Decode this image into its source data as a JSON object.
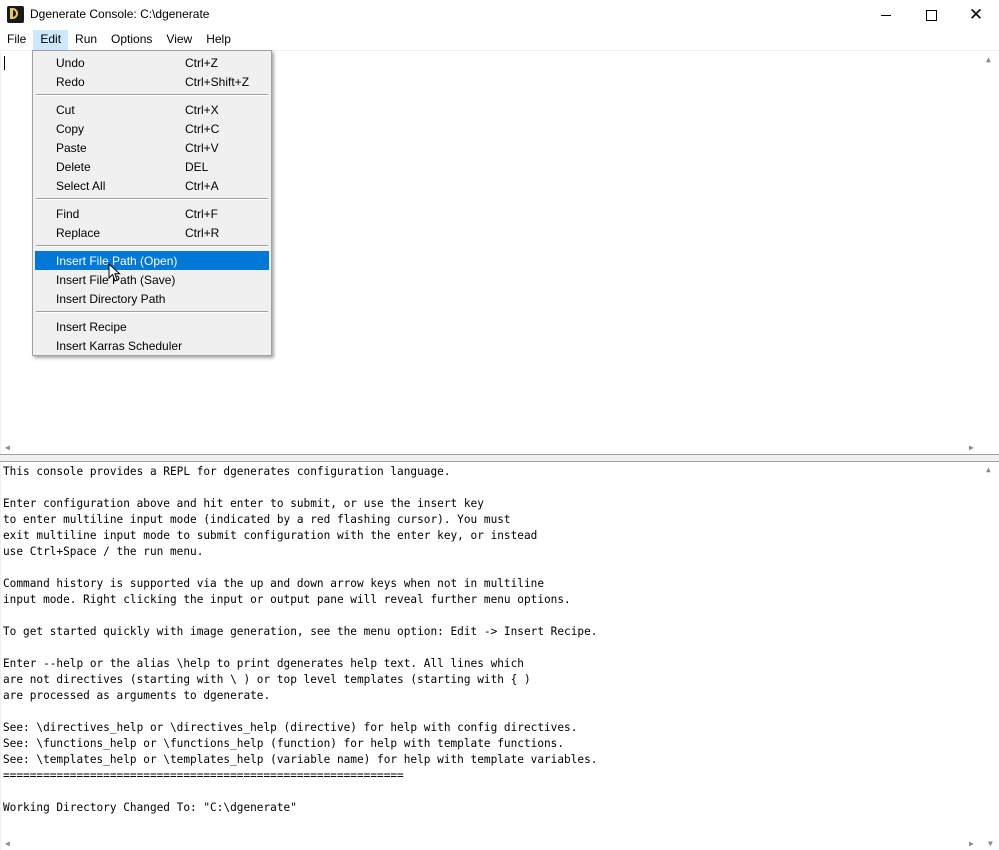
{
  "window": {
    "title": "Dgenerate Console: C:\\dgenerate",
    "icon": "dgenerate-app-icon",
    "controls": {
      "minimize": "minimize-icon",
      "maximize": "maximize-icon",
      "close": "close-icon"
    },
    "close_glyph": "✕"
  },
  "menubar": {
    "items": [
      "File",
      "Edit",
      "Run",
      "Options",
      "View",
      "Help"
    ],
    "active": "Edit"
  },
  "edit_menu": {
    "items": [
      {
        "label": "Undo",
        "shortcut": "Ctrl+Z"
      },
      {
        "label": "Redo",
        "shortcut": "Ctrl+Shift+Z"
      },
      {
        "label": "Cut",
        "shortcut": "Ctrl+X"
      },
      {
        "label": "Copy",
        "shortcut": "Ctrl+C"
      },
      {
        "label": "Paste",
        "shortcut": "Ctrl+V"
      },
      {
        "label": "Delete",
        "shortcut": "DEL"
      },
      {
        "label": "Select All",
        "shortcut": "Ctrl+A"
      },
      {
        "label": "Find",
        "shortcut": "Ctrl+F"
      },
      {
        "label": "Replace",
        "shortcut": "Ctrl+R"
      },
      {
        "label": "Insert File Path (Open)",
        "shortcut": ""
      },
      {
        "label": "Insert File Path (Save)",
        "shortcut": ""
      },
      {
        "label": "Insert Directory Path",
        "shortcut": ""
      },
      {
        "label": "Insert Recipe",
        "shortcut": ""
      },
      {
        "label": "Insert Karras Scheduler",
        "shortcut": ""
      }
    ],
    "highlighted": "Insert File Path (Open)"
  },
  "output": {
    "text": "This console provides a REPL for dgenerates configuration language.\n\nEnter configuration above and hit enter to submit, or use the insert key\nto enter multiline input mode (indicated by a red flashing cursor). You must\nexit multiline input mode to submit configuration with the enter key, or instead\nuse Ctrl+Space / the run menu.\n\nCommand history is supported via the up and down arrow keys when not in multiline\ninput mode. Right clicking the input or output pane will reveal further menu options.\n\nTo get started quickly with image generation, see the menu option: Edit -> Insert Recipe.\n\nEnter --help or the alias \\help to print dgenerates help text. All lines which\nare not directives (starting with \\ ) or top level templates (starting with { )\nare processed as arguments to dgenerate.\n\nSee: \\directives_help or \\directives_help (directive) for help with config directives.\nSee: \\functions_help or \\functions_help (function) for help with template functions.\nSee: \\templates_help or \\templates_help (variable name) for help with template variables.\n============================================================\n\nWorking Directory Changed To: \"C:\\dgenerate\""
  },
  "colors": {
    "menu_highlight": "#0078d7",
    "menubar_active": "#cce8ff",
    "pane_background": "#ffffff",
    "chrome": "#f0f0f0"
  }
}
